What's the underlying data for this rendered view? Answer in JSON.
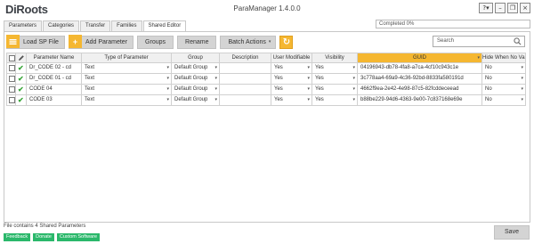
{
  "app": {
    "logo_left": "Di",
    "logo_mid": "Roo",
    "logo_right": "ts",
    "title": "ParaManager 1.4.0.0",
    "help_label": "?",
    "help_caret": "▾",
    "minimize": "–",
    "restore": "❐",
    "close": "×"
  },
  "tabs": [
    "Parameters",
    "Categories",
    "Transfer",
    "Families",
    "Shared Editor"
  ],
  "progress": {
    "text": "Completed 0%",
    "fraction": 0
  },
  "toolbar": {
    "load_label": "Load SP File",
    "add_label": "Add Parameter",
    "groups_label": "Groups",
    "rename_label": "Rename",
    "batch_label": "Batch Actions",
    "batch_caret": "▾",
    "add_icon": "+",
    "refresh_icon": "↻"
  },
  "search": {
    "placeholder": "Search"
  },
  "table": {
    "headers": {
      "name": "Parameter Name",
      "type": "Type of Parameter",
      "group": "Group",
      "description": "Description",
      "modifiable": "User Modifiable",
      "visibility": "Visibility",
      "guid": "GUID",
      "hide": "Hide When No Value"
    },
    "sort_caret": "▾",
    "dd_caret": "▾",
    "rows": [
      {
        "check": "✔",
        "name": "Dr_CODE 02 - cd",
        "type": "Text",
        "group": "Default Group",
        "description": "",
        "modifiable": "Yes",
        "visibility": "Yes",
        "guid": "04196943-db78-4fa8-a7ca-4cf10c943c1e",
        "hide": "No"
      },
      {
        "check": "✔",
        "name": "Dr_CODE 01 - cd",
        "type": "Text",
        "group": "Default Group",
        "description": "",
        "modifiable": "Yes",
        "visibility": "Yes",
        "guid": "3c778aa4-69a9-4c36-92bd-8833fa580191d",
        "hide": "No"
      },
      {
        "check": "✔",
        "name": "CODE 04",
        "type": "Text",
        "group": "Default Group",
        "description": "",
        "modifiable": "Yes",
        "visibility": "Yes",
        "guid": "4662f9ea-2e42-4e98-87c5-82fcddeceead",
        "hide": "No"
      },
      {
        "check": "✔",
        "name": "CODE 03",
        "type": "Text",
        "group": "Default Group",
        "description": "",
        "modifiable": "Yes",
        "visibility": "Yes",
        "guid": "b88be229-94d6-4363-9e00-7c837168e69e",
        "hide": "No"
      }
    ]
  },
  "status": "File contains 4 Shared Parameters",
  "footer": {
    "feedback": "Feedback",
    "donate": "Donate",
    "custom": "Custom Software"
  },
  "save_label": "Save",
  "colors": {
    "accent": "#f5b731",
    "green": "#2bb86b",
    "check": "#3aa63a"
  }
}
